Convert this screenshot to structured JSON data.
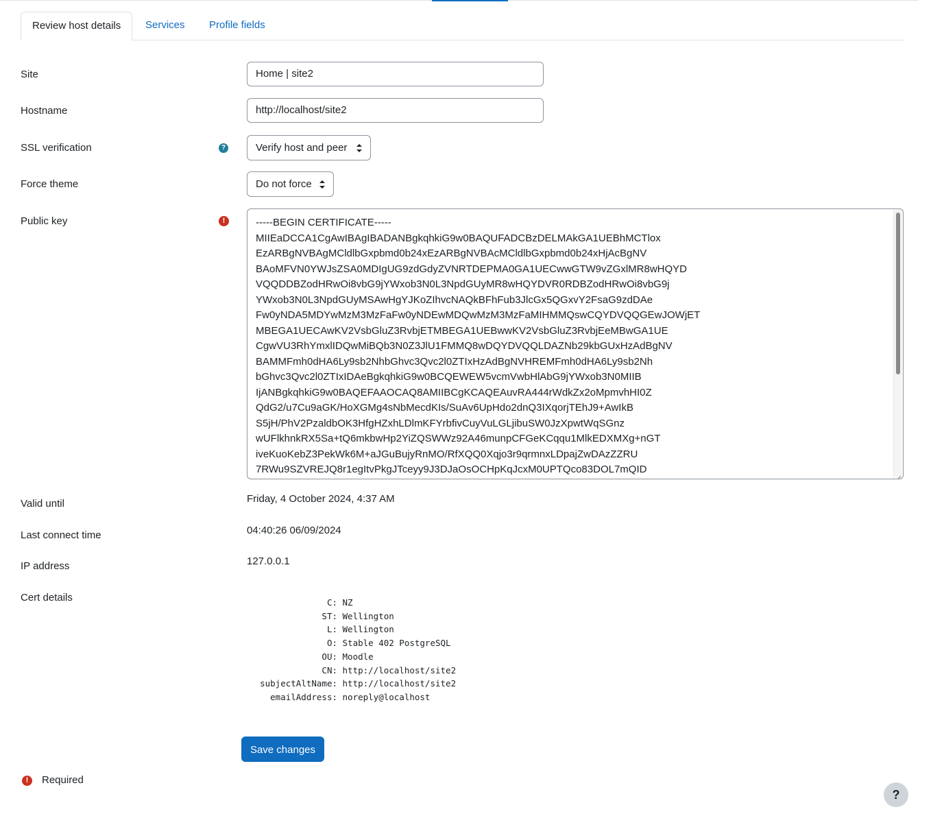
{
  "tabs": [
    {
      "label": "Review host details"
    },
    {
      "label": "Services"
    },
    {
      "label": "Profile fields"
    }
  ],
  "form": {
    "site_label": "Site",
    "site_value": "Home | site2",
    "hostname_label": "Hostname",
    "hostname_value": "http://localhost/site2",
    "ssl_label": "SSL verification",
    "ssl_value": "Verify host and peer",
    "force_theme_label": "Force theme",
    "force_theme_value": "Do not force",
    "public_key_label": "Public key",
    "public_key_lines": [
      "-----BEGIN CERTIFICATE-----",
      "MIIEaDCCA1CgAwIBAgIBADANBgkqhkiG9w0BAQUFADCBzDELMAkGA1UEBhMCTlox",
      "EzARBgNVBAgMCldlbGxpbmd0b24xEzARBgNVBAcMCldlbGxpbmd0b24xHjAcBgNV",
      "BAoMFVN0YWJsZSA0MDIgUG9zdGdyZVNRTDEPMA0GA1UECwwGTW9vZGxlMR8wHQYD",
      "VQQDDBZodHRwOi8vbG9jYWxob3N0L3NpdGUyMR8wHQYDVR0RDBZodHRwOi8vbG9j",
      "YWxob3N0L3NpdGUyMSAwHgYJKoZIhvcNAQkBFhFub3JlcGx5QGxvY2FsaG9zdDAe",
      "Fw0yNDA5MDYwMzM3MzFaFw0yNDEwMDQwMzM3MzFaMIHMMQswCQYDVQQGEwJOWjET",
      "MBEGA1UECAwKV2VsbGluZ3RvbjETMBEGA1UEBwwKV2VsbGluZ3RvbjEeMBwGA1UE",
      "CgwVU3RhYmxlIDQwMiBQb3N0Z3JlU1FMMQ8wDQYDVQQLDAZNb29kbGUxHzAdBgNV",
      "BAMMFmh0dHA6Ly9sb2NhbGhvc3Qvc2l0ZTIxHzAdBgNVHREMFmh0dHA6Ly9sb2Nh",
      "bGhvc3Qvc2l0ZTIxIDAeBgkqhkiG9w0BCQEWEW5vcmVwbHlAbG9jYWxob3N0MIIB",
      "IjANBgkqhkiG9w0BAQEFAAOCAQ8AMIIBCgKCAQEAuvRA444rWdkZx2oMpmvhHI0Z",
      "QdG2/u7Cu9aGK/HoXGMg4sNbMecdKIs/SuAv6UpHdo2dnQ3IXqorjTEhJ9+AwIkB",
      "S5jH/PhV2PzaldbOK3HfgHZxhLDlmKFYrbfivCuyVuLGLjibuSW0JzXpwtWqSGnz",
      "wUFlkhnkRX5Sa+tQ6mkbwHp2YiZQSWWz92A46munpCFGeKCqqu1MlkEDXMXg+nGT",
      "iveKuoKebZ3PekWk6M+aJGuBujyRnMO/RfXQQ0Xqjo3r9qrmnxLDpajZwDAzZZRU",
      "7RWu9SZVREJQ8r1egItvPkgJTceyy9J3DJaOsOCHpKqJcxM0UPTQco83DOL7mQID"
    ],
    "valid_until_label": "Valid until",
    "valid_until_value": "Friday, 4 October 2024, 4:37 AM",
    "last_connect_label": "Last connect time",
    "last_connect_value": "04:40:26 06/09/2024",
    "ip_label": "IP address",
    "ip_value": "127.0.0.1",
    "cert_details_label": "Cert details",
    "cert_details": [
      {
        "key": "C:",
        "value": "NZ"
      },
      {
        "key": "ST:",
        "value": "Wellington"
      },
      {
        "key": "L:",
        "value": "Wellington"
      },
      {
        "key": "O:",
        "value": "Stable 402 PostgreSQL"
      },
      {
        "key": "OU:",
        "value": "Moodle"
      },
      {
        "key": "CN:",
        "value": "http://localhost/site2"
      },
      {
        "key": "subjectAltName:",
        "value": "http://localhost/site2"
      },
      {
        "key": "emailAddress:",
        "value": "noreply@localhost"
      }
    ],
    "save_label": "Save changes",
    "required_label": "Required"
  },
  "icons": {
    "help": "help-icon",
    "required": "exclamation-circle-icon",
    "help_fab": "question-mark-icon"
  },
  "help_glyph": "?",
  "required_glyph": "!",
  "colors": {
    "primary": "#0f6cbf",
    "danger": "#ca3120",
    "info": "#1f7e9a"
  }
}
